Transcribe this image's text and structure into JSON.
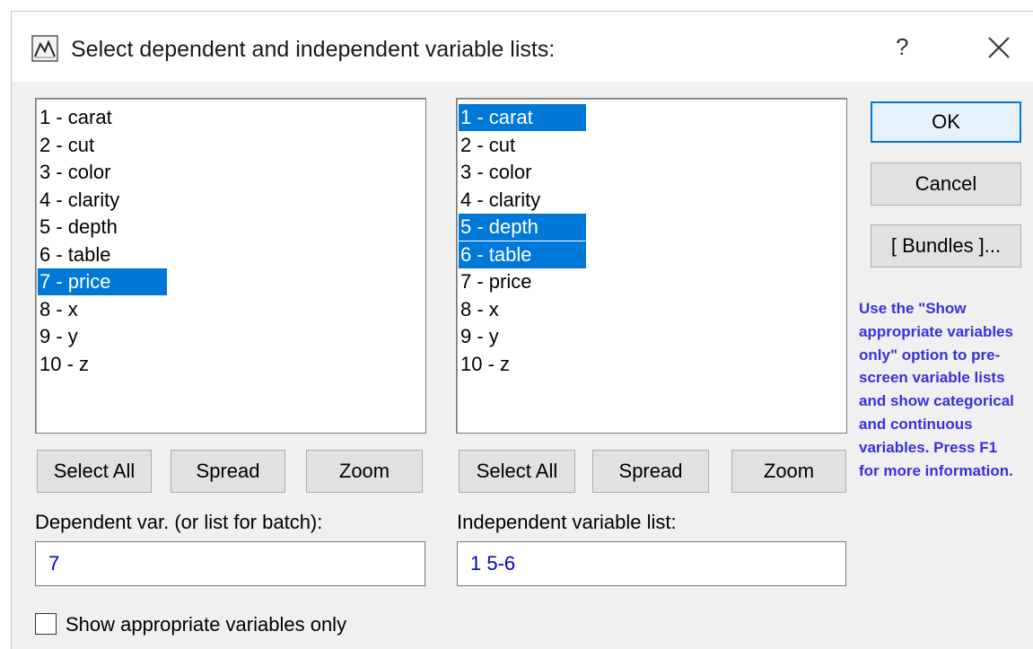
{
  "window": {
    "title": "Select dependent and independent variable lists:",
    "help_label": "?",
    "app_icon": "chart-icon",
    "close_icon": "close-icon"
  },
  "dependent_list": {
    "items": [
      {
        "label": "1 - carat",
        "selected": false
      },
      {
        "label": "2 - cut",
        "selected": false
      },
      {
        "label": "3 - color",
        "selected": false
      },
      {
        "label": "4 - clarity",
        "selected": false
      },
      {
        "label": "5 - depth",
        "selected": false
      },
      {
        "label": "6 - table",
        "selected": false
      },
      {
        "label": "7 - price",
        "selected": true
      },
      {
        "label": "8 - x",
        "selected": false
      },
      {
        "label": "9 - y",
        "selected": false
      },
      {
        "label": "10 - z",
        "selected": false
      }
    ],
    "select_all_label": "Select All",
    "spread_label": "Spread",
    "zoom_label": "Zoom",
    "field_label": "Dependent var. (or list for batch):",
    "field_value": "7"
  },
  "independent_list": {
    "items": [
      {
        "label": "1 - carat",
        "selected": true
      },
      {
        "label": "2 - cut",
        "selected": false
      },
      {
        "label": "3 - color",
        "selected": false
      },
      {
        "label": "4 - clarity",
        "selected": false
      },
      {
        "label": "5 - depth",
        "selected": true
      },
      {
        "label": "6 - table",
        "selected": true
      },
      {
        "label": "7 - price",
        "selected": false
      },
      {
        "label": "8 - x",
        "selected": false
      },
      {
        "label": "9 - y",
        "selected": false
      },
      {
        "label": "10 - z",
        "selected": false
      }
    ],
    "select_all_label": "Select All",
    "spread_label": "Spread",
    "zoom_label": "Zoom",
    "field_label": "Independent variable list:",
    "field_value": "1 5-6"
  },
  "buttons": {
    "ok_label": "OK",
    "cancel_label": "Cancel",
    "bundles_label": "[ Bundles ]..."
  },
  "hint_text": "Use the \"Show appropriate variables only\" option to pre-screen variable lists and show categorical and continuous variables. Press F1 for more information.",
  "checkbox": {
    "label": "Show appropriate variables only",
    "checked": false
  },
  "colors": {
    "selection": "#0078d7",
    "hint": "#3a2fdc",
    "field_value": "#0000cc"
  }
}
